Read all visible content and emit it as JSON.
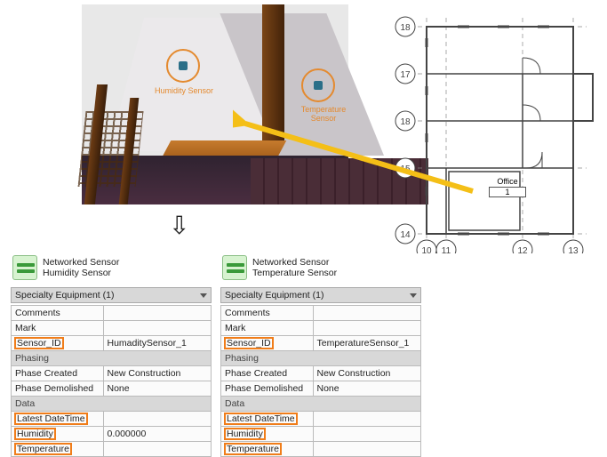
{
  "room3d": {
    "sensors": {
      "humidity": {
        "label": "Humidity Sensor"
      },
      "temperature": {
        "label": "Temperature Sensor"
      }
    }
  },
  "plan": {
    "rows": [
      "18",
      "17",
      "18",
      "15",
      "14"
    ],
    "cols": [
      "10",
      "11",
      "12",
      "13"
    ],
    "room_label": "Office",
    "room_number": "1"
  },
  "panels": {
    "a": {
      "header1": "Networked Sensor",
      "header2": "Humidity Sensor",
      "selector": "Specialty Equipment (1)",
      "sections": {
        "phasing": "Phasing",
        "data": "Data"
      },
      "rows": {
        "comments": {
          "k": "Comments",
          "v": ""
        },
        "mark": {
          "k": "Mark",
          "v": ""
        },
        "sensor_id": {
          "k": "Sensor_ID",
          "v": "HumaditySensor_1"
        },
        "phase_cr": {
          "k": "Phase Created",
          "v": "New Construction"
        },
        "phase_dm": {
          "k": "Phase Demolished",
          "v": "None"
        },
        "ldt": {
          "k": "Latest DateTime",
          "v": ""
        },
        "hum": {
          "k": "Humidity",
          "v": "0.000000"
        },
        "temp": {
          "k": "Temperature",
          "v": ""
        }
      }
    },
    "b": {
      "header1": "Networked Sensor",
      "header2": "Temperature Sensor",
      "selector": "Specialty Equipment (1)",
      "sections": {
        "phasing": "Phasing",
        "data": "Data"
      },
      "rows": {
        "comments": {
          "k": "Comments",
          "v": ""
        },
        "mark": {
          "k": "Mark",
          "v": ""
        },
        "sensor_id": {
          "k": "Sensor_ID",
          "v": "TemperatureSensor_1"
        },
        "phase_cr": {
          "k": "Phase Created",
          "v": "New Construction"
        },
        "phase_dm": {
          "k": "Phase Demolished",
          "v": "None"
        },
        "ldt": {
          "k": "Latest DateTime",
          "v": ""
        },
        "hum": {
          "k": "Humidity",
          "v": ""
        },
        "temp": {
          "k": "Temperature",
          "v": ""
        }
      }
    }
  }
}
